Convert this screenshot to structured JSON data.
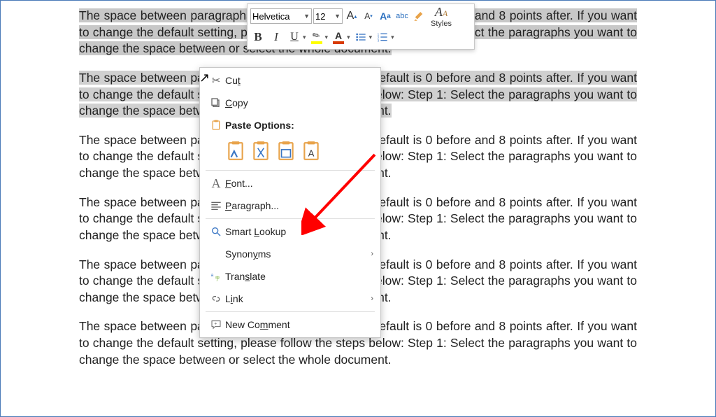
{
  "document": {
    "paragraph_text": "The space between paragraphs in Microsoft Word by default is 0 before and 8 points after. If you want to change the default setting, please follow the steps below: Step 1: Select the paragraphs you want to change the space between or select the whole document.",
    "paragraphs_repeat": 6,
    "selected_paragraphs": [
      0,
      1
    ]
  },
  "mini_toolbar": {
    "font_name": "Helvetica",
    "font_size": "12",
    "grow_font_tooltip": "Increase Font Size",
    "shrink_font_tooltip": "Decrease Font Size",
    "change_case_label": "Aa",
    "clear_formatting_label": "abc",
    "styles_label": "Styles",
    "bold": "B",
    "italic": "I",
    "underline": "U",
    "highlight_color": "#ffff00",
    "font_color": "#d83b01"
  },
  "context_menu": {
    "cut": "Cut",
    "copy": "Copy",
    "paste_options_header": "Paste Options:",
    "paste_options": [
      "Keep Source Formatting",
      "Merge Formatting",
      "Picture",
      "Keep Text Only"
    ],
    "font": "Font...",
    "paragraph": "Paragraph...",
    "smart_lookup": "Smart Lookup",
    "synonyms": "Synonyms",
    "translate": "Translate",
    "link": "Link",
    "new_comment": "New Comment"
  },
  "annotation": {
    "arrow_target": "paragraph-menu-item",
    "arrow_color": "#ff0000"
  }
}
